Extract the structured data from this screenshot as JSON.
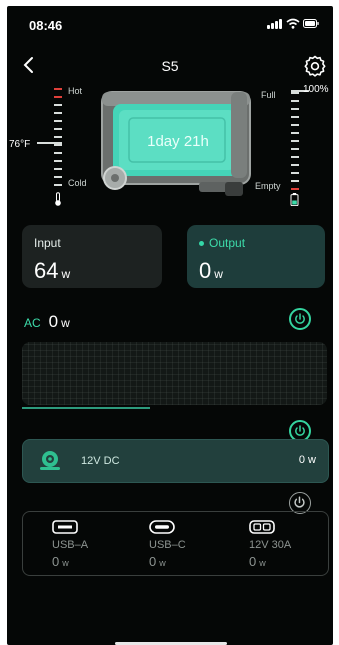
{
  "status_bar": {
    "time": "08:46"
  },
  "header": {
    "title": "S5"
  },
  "temperature_gauge": {
    "hot_label": "Hot",
    "cold_label": "Cold",
    "current_label": "76°F"
  },
  "battery_gauge": {
    "full_label": "Full",
    "empty_label": "Empty",
    "percent_label": "100%"
  },
  "device": {
    "runtime": "1day 21h"
  },
  "input": {
    "label": "Input",
    "value": "64",
    "unit": "w"
  },
  "output": {
    "label": "Output",
    "value": "0",
    "unit": "w"
  },
  "ac": {
    "tag": "AC",
    "value": "0",
    "unit": "w",
    "progress": 0.42
  },
  "dc": {
    "label": "12V DC",
    "value": "0 w"
  },
  "ports": [
    {
      "name": "USB–A",
      "value": "0",
      "unit": "w",
      "icon": "usb-a-icon"
    },
    {
      "name": "USB–C",
      "value": "0",
      "unit": "w",
      "icon": "usb-c-icon"
    },
    {
      "name": "12V 30A",
      "value": "0",
      "unit": "w",
      "icon": "car-socket-icon"
    }
  ],
  "colors": {
    "accent": "#35d49f",
    "background": "#050706",
    "card": "#1d2221",
    "output_card": "#1e3d3b",
    "hot": "#e0403a"
  }
}
